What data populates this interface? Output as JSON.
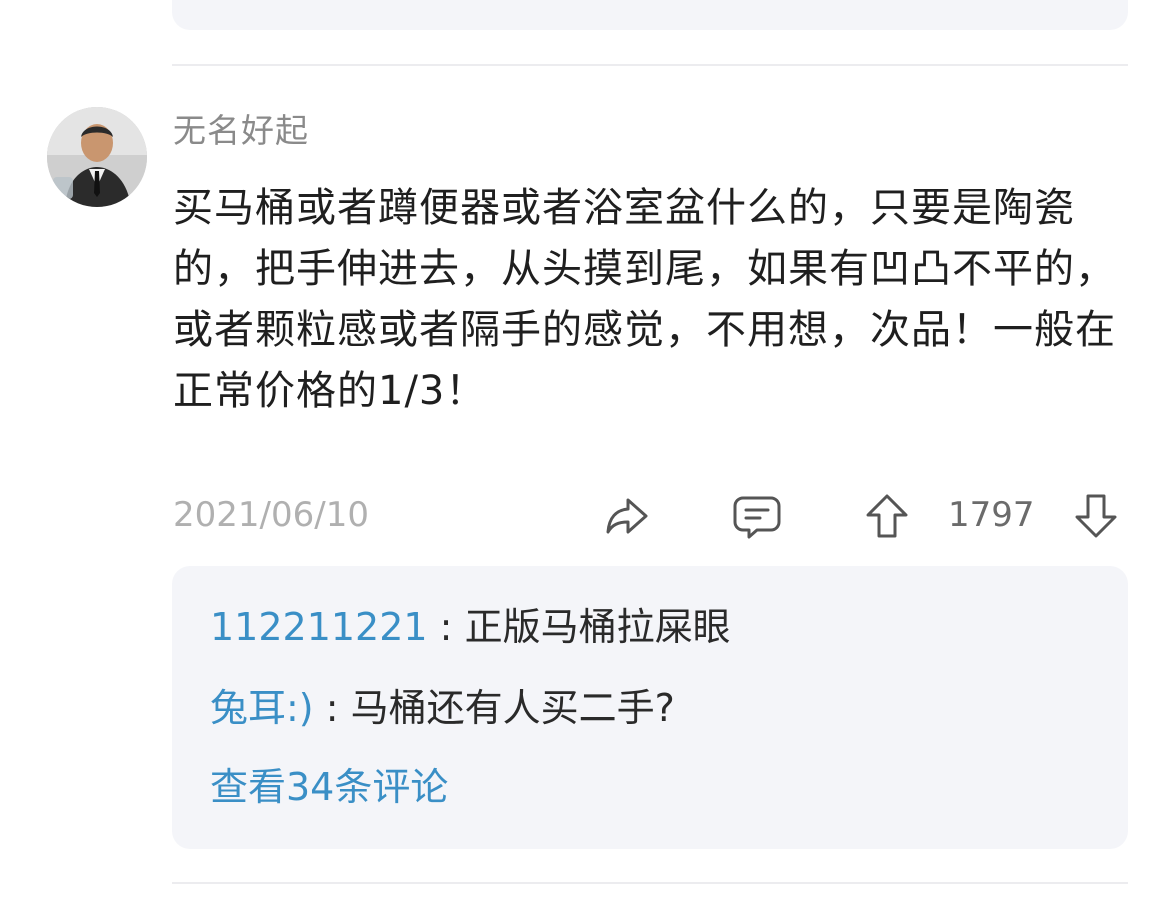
{
  "comment": {
    "author": "无名好起",
    "avatar_alt": "avatar",
    "body": "买马桶或者蹲便器或者浴室盆什么的，只要是陶瓷的，把手伸进去，从头摸到尾，如果有凹凸不平的，或者颗粒感或者隔手的感觉，不用想，次品！一般在正常价格的1/3！",
    "date": "2021/06/10",
    "vote_count": "1797",
    "icons": {
      "share": "share-icon",
      "comment": "comment-icon",
      "upvote": "arrow-up-icon",
      "downvote": "arrow-down-icon"
    },
    "replies": [
      {
        "user": "112211221",
        "separator": " : ",
        "text": "正版马桶拉屎眼"
      },
      {
        "user": "兔耳:)",
        "separator": " : ",
        "text": "马桶还有人买二手?"
      }
    ],
    "view_more": "查看34条评论"
  },
  "colors": {
    "link": "#3a8fc6",
    "muted": "#8a8a8a",
    "card_bg": "#f4f5f9",
    "icon_stroke": "#555555"
  }
}
